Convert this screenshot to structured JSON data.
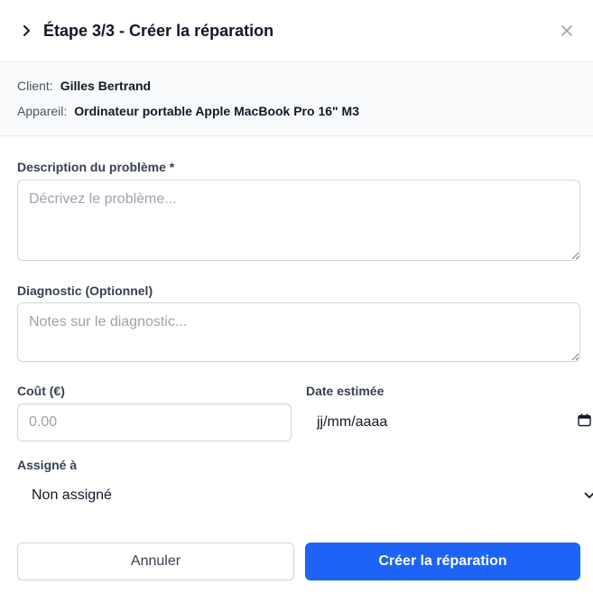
{
  "header": {
    "title": "Étape 3/3 - Créer la réparation"
  },
  "info": {
    "client_label": "Client:",
    "client_value": "Gilles Bertrand",
    "device_label": "Appareil:",
    "device_value": "Ordinateur portable Apple MacBook Pro 16\" M3"
  },
  "form": {
    "description": {
      "label": "Description du problème *",
      "value": "",
      "placeholder": "Décrivez le problème..."
    },
    "diagnostic": {
      "label": "Diagnostic (Optionnel)",
      "value": "",
      "placeholder": "Notes sur le diagnostic..."
    },
    "cost": {
      "label": "Coût (€)",
      "value": "",
      "placeholder": "0.00"
    },
    "date": {
      "label": "Date estimée",
      "value": "jj/mm/aaaa"
    },
    "assigned": {
      "label": "Assigné à",
      "value": "Non assigné"
    }
  },
  "actions": {
    "cancel_label": "Annuler",
    "create_label": "Créer la réparation"
  },
  "colors": {
    "primary": "#1d63f5",
    "border": "#d1d5db",
    "panel_bg": "#f9fafb"
  },
  "icons": {
    "back": "chevron-right-icon",
    "close": "close-icon",
    "calendar": "calendar-icon",
    "select": "chevron-down-icon"
  }
}
